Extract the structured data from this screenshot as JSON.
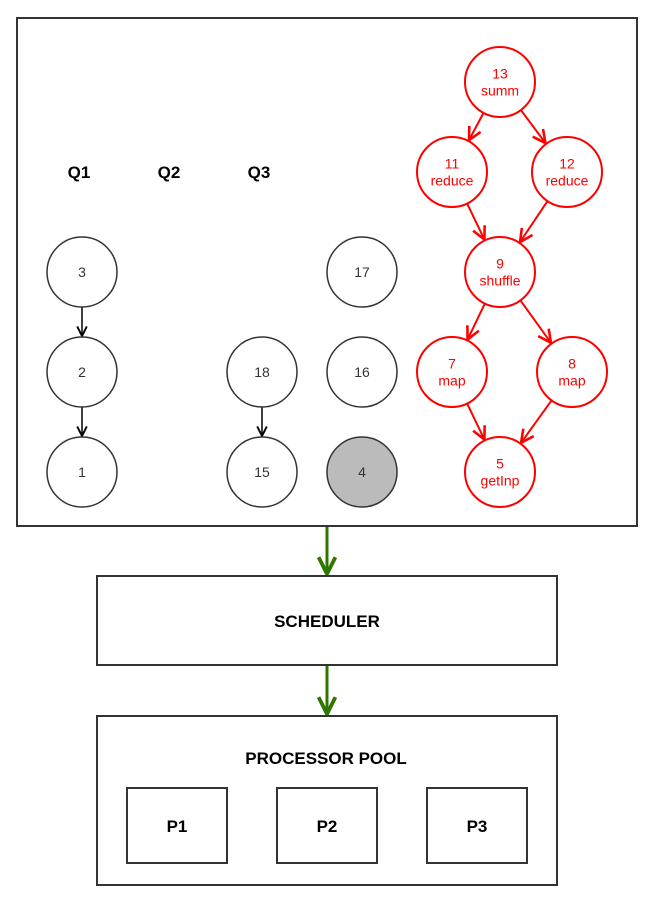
{
  "queues": {
    "labels": [
      "Q1",
      "Q2",
      "Q3"
    ]
  },
  "nodes": [
    {
      "id": "n3",
      "lines": [
        "3"
      ],
      "style": "plain"
    },
    {
      "id": "n2",
      "lines": [
        "2"
      ],
      "style": "plain"
    },
    {
      "id": "n1",
      "lines": [
        "1"
      ],
      "style": "plain"
    },
    {
      "id": "n18",
      "lines": [
        "18"
      ],
      "style": "plain"
    },
    {
      "id": "n15",
      "lines": [
        "15"
      ],
      "style": "plain"
    },
    {
      "id": "n17",
      "lines": [
        "17"
      ],
      "style": "plain"
    },
    {
      "id": "n16",
      "lines": [
        "16"
      ],
      "style": "plain"
    },
    {
      "id": "n4",
      "lines": [
        "4"
      ],
      "style": "active"
    },
    {
      "id": "n13",
      "lines": [
        "13",
        "summ"
      ],
      "style": "highlight"
    },
    {
      "id": "n11",
      "lines": [
        "11",
        "reduce"
      ],
      "style": "highlight"
    },
    {
      "id": "n12",
      "lines": [
        "12",
        "reduce"
      ],
      "style": "highlight"
    },
    {
      "id": "n9",
      "lines": [
        "9",
        "shuffle"
      ],
      "style": "highlight"
    },
    {
      "id": "n7",
      "lines": [
        "7",
        "map"
      ],
      "style": "highlight"
    },
    {
      "id": "n8",
      "lines": [
        "8",
        "map"
      ],
      "style": "highlight"
    },
    {
      "id": "n5",
      "lines": [
        "5",
        "getInp"
      ],
      "style": "highlight"
    }
  ],
  "edges": [
    {
      "from": "n3",
      "to": "n2",
      "style": "plain"
    },
    {
      "from": "n2",
      "to": "n1",
      "style": "plain"
    },
    {
      "from": "n18",
      "to": "n15",
      "style": "plain"
    },
    {
      "from": "n13",
      "to": "n11",
      "style": "highlight"
    },
    {
      "from": "n13",
      "to": "n12",
      "style": "highlight"
    },
    {
      "from": "n11",
      "to": "n9",
      "style": "highlight"
    },
    {
      "from": "n12",
      "to": "n9",
      "style": "highlight"
    },
    {
      "from": "n9",
      "to": "n7",
      "style": "highlight"
    },
    {
      "from": "n9",
      "to": "n8",
      "style": "highlight"
    },
    {
      "from": "n7",
      "to": "n5",
      "style": "highlight"
    },
    {
      "from": "n8",
      "to": "n5",
      "style": "highlight"
    }
  ],
  "scheduler": {
    "label": "SCHEDULER"
  },
  "processor_pool": {
    "label": "PROCESSOR POOL",
    "processors": [
      "P1",
      "P2",
      "P3"
    ]
  },
  "colors": {
    "plain_stroke": "#333333",
    "plain_text": "#333333",
    "highlight": "#ff0000",
    "active_fill": "#bbbbbb",
    "flow_arrow": "#2d7600"
  }
}
